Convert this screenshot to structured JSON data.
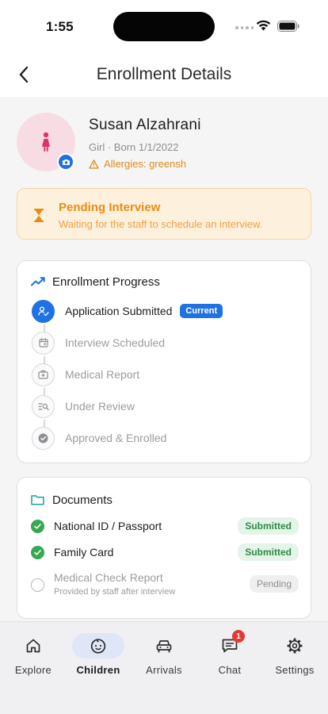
{
  "status_bar": {
    "time": "1:55"
  },
  "nav": {
    "title": "Enrollment Details"
  },
  "profile": {
    "name": "Susan Alzahrani",
    "meta": "Girl · Born 1/1/2022",
    "allergies": "Allergies: greensh"
  },
  "pending": {
    "title": "Pending Interview",
    "subtitle": "Waiting for the staff to schedule an interview."
  },
  "progress": {
    "title": "Enrollment Progress",
    "current_badge": "Current",
    "steps": [
      {
        "label": "Application Submitted",
        "icon": "user-check-icon",
        "state": "current"
      },
      {
        "label": "Interview Scheduled",
        "icon": "calendar-icon",
        "state": "upcoming"
      },
      {
        "label": "Medical Report",
        "icon": "medical-kit-icon",
        "state": "upcoming"
      },
      {
        "label": "Under Review",
        "icon": "review-list-icon",
        "state": "upcoming"
      },
      {
        "label": "Approved & Enrolled",
        "icon": "check-circle-icon",
        "state": "upcoming"
      }
    ]
  },
  "documents": {
    "title": "Documents",
    "items": [
      {
        "label": "National ID / Passport",
        "status": "Submitted"
      },
      {
        "label": "Family Card",
        "status": "Submitted"
      },
      {
        "label": "Medical Check Report",
        "note": "Provided by staff after interview",
        "status": "Pending"
      }
    ]
  },
  "tabs": [
    {
      "label": "Explore",
      "icon": "home-icon"
    },
    {
      "label": "Children",
      "icon": "child-face-icon",
      "active": true
    },
    {
      "label": "Arrivals",
      "icon": "car-icon"
    },
    {
      "label": "Chat",
      "icon": "chat-icon",
      "badge": "1"
    },
    {
      "label": "Settings",
      "icon": "gear-icon"
    }
  ],
  "colors": {
    "accent": "#1e72e4",
    "warning": "#ef8a10",
    "success": "#34a853",
    "avatar_bg": "#f8dce3",
    "child_icon": "#e0306b"
  }
}
